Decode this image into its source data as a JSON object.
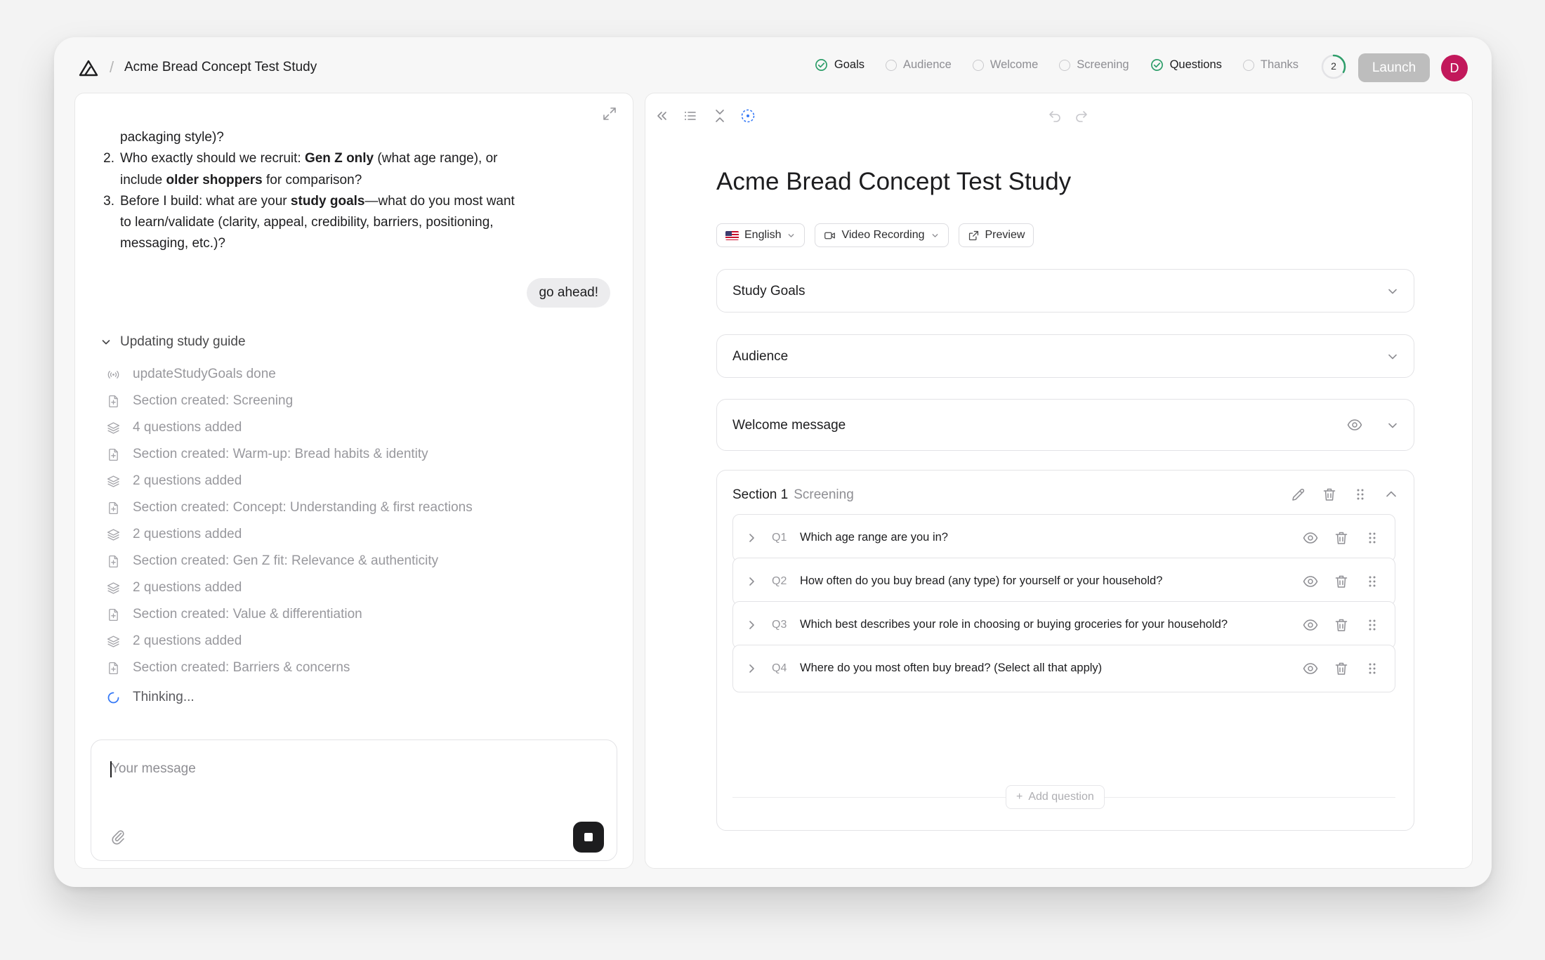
{
  "header": {
    "study_title": "Acme Bread Concept Test Study",
    "breadcrumb_separator": "/",
    "steps": [
      {
        "label": "Goals",
        "status": "done"
      },
      {
        "label": "Audience",
        "status": "pending"
      },
      {
        "label": "Welcome",
        "status": "pending"
      },
      {
        "label": "Screening",
        "status": "pending"
      },
      {
        "label": "Questions",
        "status": "done"
      },
      {
        "label": "Thanks",
        "status": "pending"
      }
    ],
    "progress_count": "2",
    "progress_fraction": 0.33,
    "launch_label": "Launch",
    "avatar_initial": "D",
    "accent_color": "#2e9e6a",
    "avatar_color": "#c2185b"
  },
  "chat": {
    "message_lines": [
      {
        "num": "",
        "html": "packaging style)?"
      },
      {
        "num": "2.",
        "html": "Who exactly should we recruit: <b>Gen Z only</b> (what age range), or"
      },
      {
        "num": "",
        "html": "include <b>older shoppers</b> for comparison?"
      },
      {
        "num": "3.",
        "html": "Before I build: what are your <b>study goals</b>—what do you most want"
      },
      {
        "num": "",
        "html": "to learn/validate (clarity, appeal, credibility, barriers, positioning,"
      },
      {
        "num": "",
        "html": "messaging, etc.)?"
      }
    ],
    "user_message": "go ahead!",
    "tool_group_title": "Updating study guide",
    "tool_items": [
      {
        "icon": "broadcast-icon",
        "text": "updateStudyGoals done"
      },
      {
        "icon": "file-plus-icon",
        "text": "Section created: Screening"
      },
      {
        "icon": "layers-icon",
        "text": "4 questions added"
      },
      {
        "icon": "file-plus-icon",
        "text": "Section created: Warm-up: Bread habits & identity"
      },
      {
        "icon": "layers-icon",
        "text": "2 questions added"
      },
      {
        "icon": "file-plus-icon",
        "text": "Section created: Concept: Understanding & first reactions"
      },
      {
        "icon": "layers-icon",
        "text": "2 questions added"
      },
      {
        "icon": "file-plus-icon",
        "text": "Section created: Gen Z fit: Relevance & authenticity"
      },
      {
        "icon": "layers-icon",
        "text": "2 questions added"
      },
      {
        "icon": "file-plus-icon",
        "text": "Section created: Value & differentiation"
      },
      {
        "icon": "layers-icon",
        "text": "2 questions added"
      },
      {
        "icon": "file-plus-icon",
        "text": "Section created: Barriers & concerns"
      }
    ],
    "thinking_text": "Thinking...",
    "composer_placeholder": "Your message"
  },
  "editor": {
    "title": "Acme Bread Concept Test Study",
    "language_label": "English",
    "recording_label": "Video Recording",
    "preview_label": "Preview",
    "accordions": {
      "goals": "Study Goals",
      "audience": "Audience",
      "welcome": "Welcome message"
    },
    "section": {
      "label": "Section 1",
      "name": "Screening",
      "questions": [
        {
          "num": "Q1",
          "text": "Which age range are you in?"
        },
        {
          "num": "Q2",
          "text": "How often do you buy bread (any type) for yourself or your household?"
        },
        {
          "num": "Q3",
          "text": "Which best describes your role in choosing or buying groceries for your household?"
        },
        {
          "num": "Q4",
          "text": "Where do you most often buy bread? (Select all that apply)"
        }
      ],
      "add_question_label": "Add question"
    }
  }
}
